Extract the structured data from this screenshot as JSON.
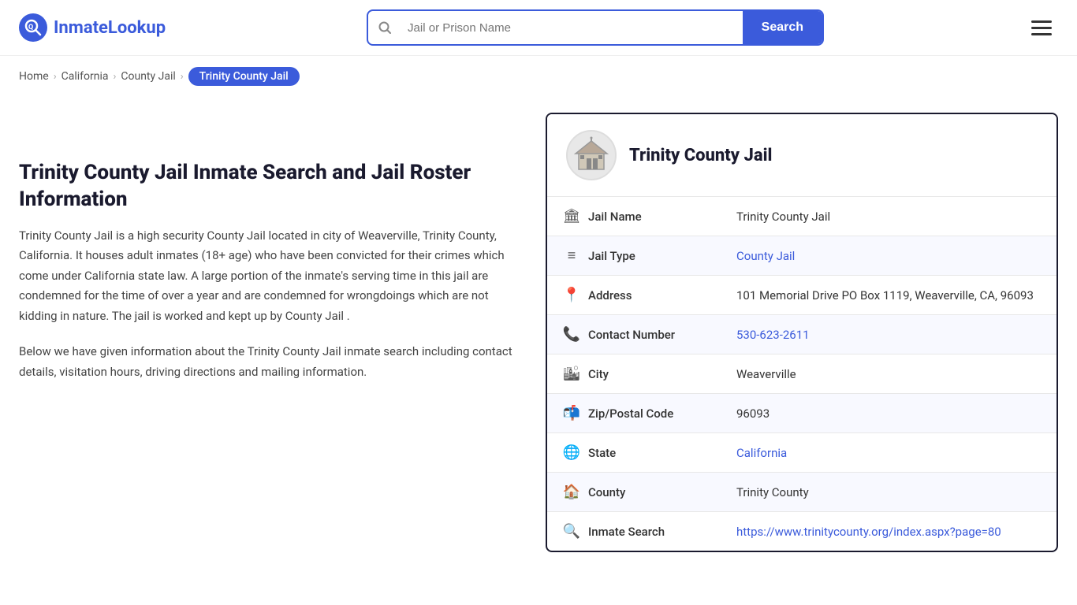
{
  "header": {
    "logo_text_1": "Inmate",
    "logo_text_2": "Lookup",
    "logo_symbol": "Q",
    "search_placeholder": "Jail or Prison Name",
    "search_button_label": "Search"
  },
  "breadcrumb": {
    "home": "Home",
    "state": "California",
    "section": "County Jail",
    "current": "Trinity County Jail"
  },
  "left": {
    "title": "Trinity County Jail Inmate Search and Jail Roster Information",
    "description_1": "Trinity County Jail is a high security County Jail located in city of Weaverville, Trinity County, California. It houses adult inmates (18+ age) who have been convicted for their crimes which come under California state law. A large portion of the inmate's serving time in this jail are condemned for the time of over a year and are condemned for wrongdoings which are not kidding in nature. The jail is worked and kept up by County Jail .",
    "description_2": "Below we have given information about the Trinity County Jail inmate search including contact details, visitation hours, driving directions and mailing information."
  },
  "card": {
    "facility_name": "Trinity County Jail",
    "rows": [
      {
        "icon": "🏛",
        "label": "Jail Name",
        "value": "Trinity County Jail",
        "link": null
      },
      {
        "icon": "≡",
        "label": "Jail Type",
        "value": "County Jail",
        "link": "#"
      },
      {
        "icon": "📍",
        "label": "Address",
        "value": "101 Memorial Drive PO Box 1119, Weaverville, CA, 96093",
        "link": null
      },
      {
        "icon": "📞",
        "label": "Contact Number",
        "value": "530-623-2611",
        "link": "tel:5306232611"
      },
      {
        "icon": "🏙",
        "label": "City",
        "value": "Weaverville",
        "link": null
      },
      {
        "icon": "📬",
        "label": "Zip/Postal Code",
        "value": "96093",
        "link": null
      },
      {
        "icon": "🌐",
        "label": "State",
        "value": "California",
        "link": "#"
      },
      {
        "icon": "🏠",
        "label": "County",
        "value": "Trinity County",
        "link": null
      },
      {
        "icon": "🔍",
        "label": "Inmate Search",
        "value": "https://www.trinitycounty.org/index.aspx?page=80",
        "link": "https://www.trinitycounty.org/index.aspx?page=80"
      }
    ]
  }
}
